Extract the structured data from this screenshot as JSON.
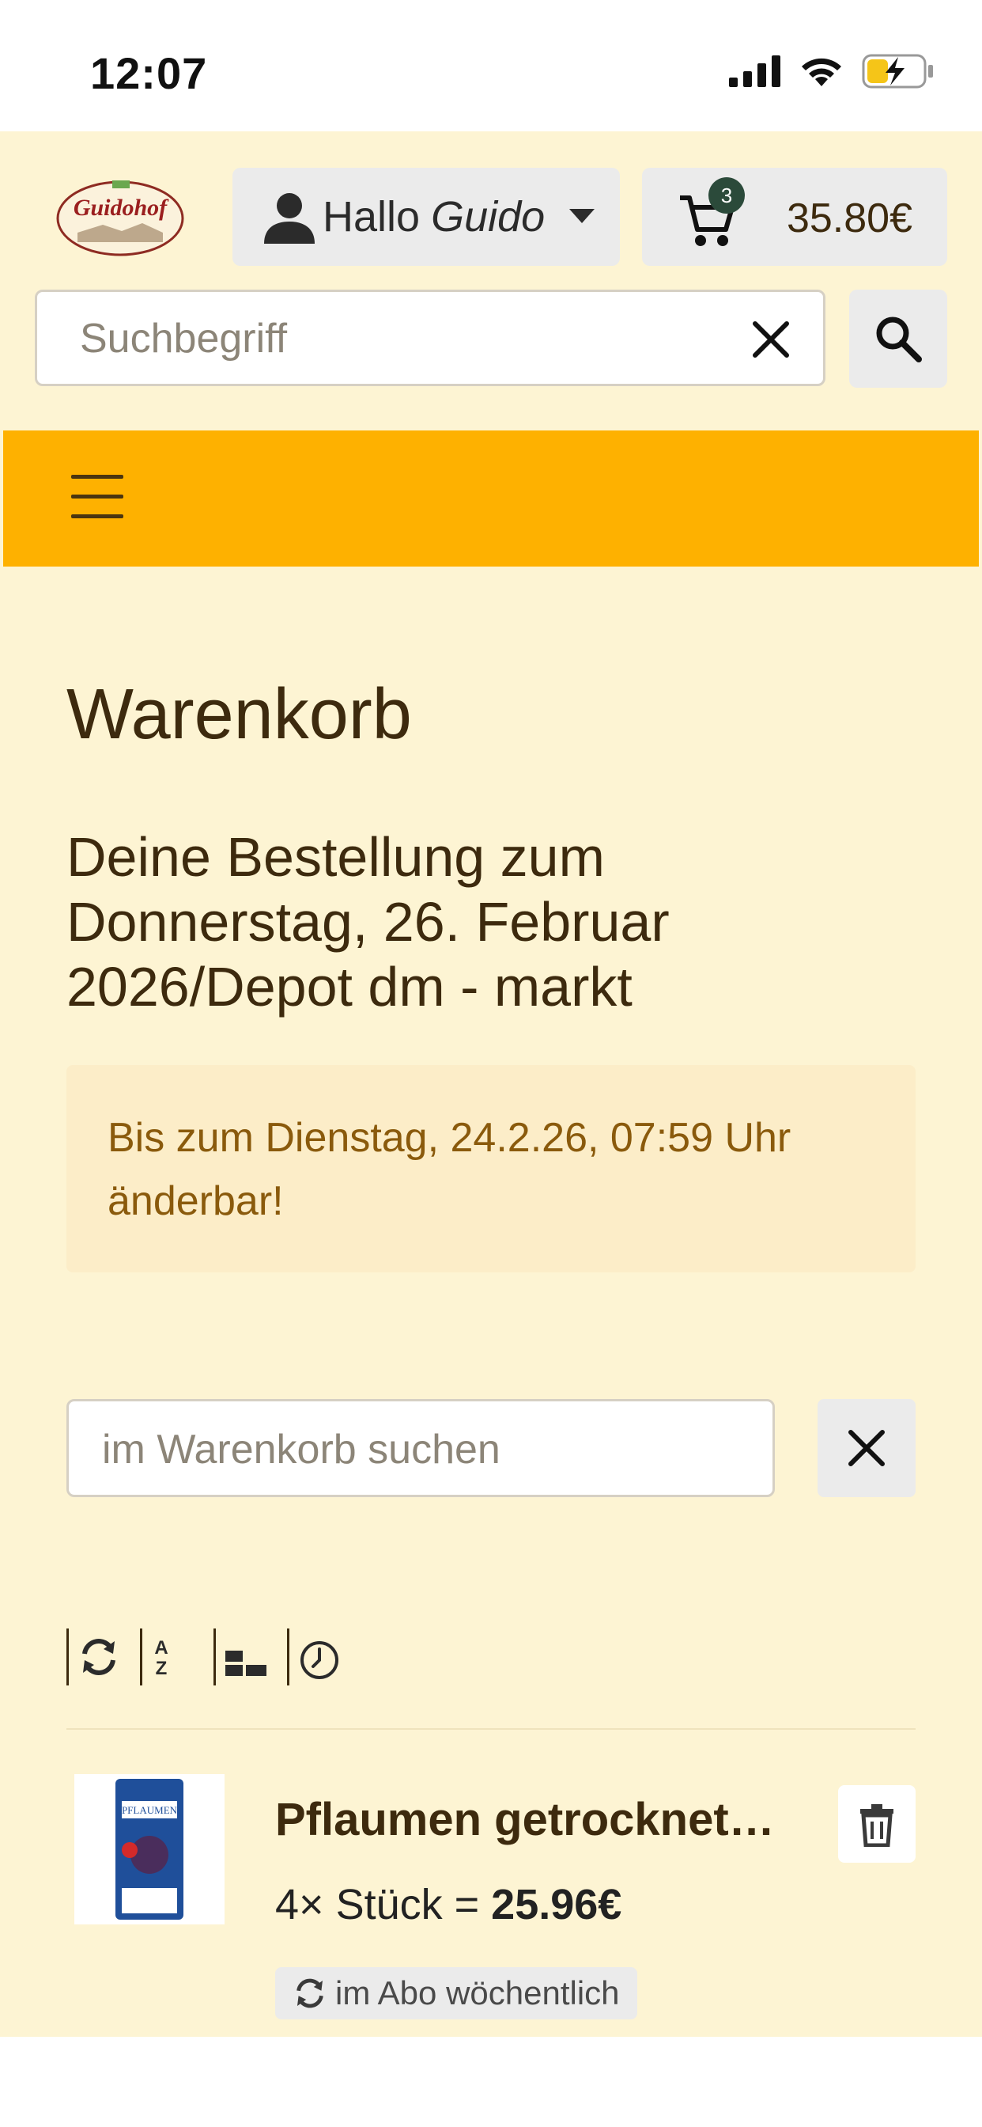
{
  "status_bar": {
    "time": "12:07"
  },
  "header": {
    "logo_text": "Guidohof",
    "user": {
      "greeting": "Hallo",
      "name": "Guido"
    },
    "cart": {
      "count": "3",
      "total": "35.80€"
    },
    "search": {
      "placeholder": "Suchbegriff"
    }
  },
  "page": {
    "title": "Warenkorb",
    "subtitle": "Deine Bestellung zum Donnerstag, 26. Februar 2026/Depot dm - markt",
    "notice": "Bis zum Dienstag, 24.2.26, 07:59 Uhr änderbar!",
    "cart_search": {
      "placeholder": "im Warenkorb suchen"
    },
    "sort_options": [
      "refresh-icon",
      "sort-az-icon",
      "sort-size-icon",
      "clock-icon"
    ]
  },
  "items": [
    {
      "name": "Pflaumen getrocknet…",
      "qty_text": "4× Stück = ",
      "price": "25.96€",
      "subscription": "im Abo wöchentlich",
      "image_label": "PFLAUMEN"
    }
  ],
  "colors": {
    "background": "#fdf4d3",
    "navbar": "#feb100",
    "notice_bg": "#fcedc8",
    "notice_text": "#8a5a0c",
    "badge": "#2b4a3a"
  }
}
